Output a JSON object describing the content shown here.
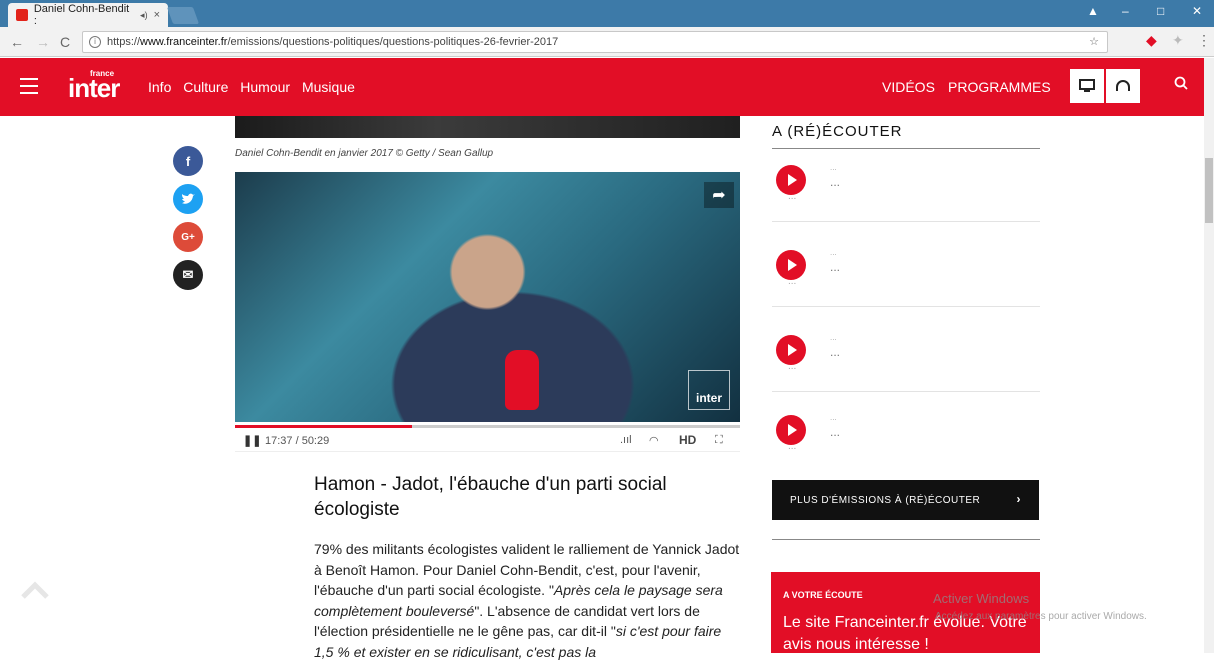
{
  "browser": {
    "tab_title": "Daniel Cohn-Bendit :",
    "tab_close": "×",
    "url_prefix": "https://",
    "url_host": "www.franceinter.fr",
    "url_path": "/emissions/questions-politiques/questions-politiques-26-fevrier-2017",
    "back": "←",
    "forward": "→",
    "reload": "C"
  },
  "header": {
    "logo_small": "france",
    "logo": "inter",
    "nav": [
      "Info",
      "Culture",
      "Humour",
      "Musique"
    ],
    "videos": "VIDÉOS",
    "programmes": "PROGRAMMES"
  },
  "social": {
    "facebook": "f",
    "twitter": "t",
    "google": "G+",
    "email": "✉"
  },
  "article": {
    "caption": "Daniel Cohn-Bendit en janvier 2017 © Getty / Sean Gallup",
    "video_watermark": "inter",
    "player_time": "17:37 / 50:29",
    "player_progress": 0.35,
    "player_hd": "HD",
    "headline": "Hamon - Jadot, l'ébauche d'un parti social écologiste",
    "body_1": "79% des militants écologistes valident le ralliement de Yannick Jadot à Benoît Hamon. Pour Daniel Cohn-Bendit, c'est, pour l'avenir, l'ébauche d'un parti social écologiste. \"",
    "body_em_1": "Après cela le paysage sera complètement bouleversé",
    "body_2": "\". L'absence de candidat vert lors de l'élection présidentielle ne le gêne pas, car dit-il \"",
    "body_em_2": "si c'est pour faire 1,5 % et exister en se ridiculisant, c'est pas la"
  },
  "sidebar": {
    "title": "A (RÉ)ÉCOUTER",
    "podcasts": [
      {
        "small": "...",
        "title": "...",
        "meta": "..."
      },
      {
        "small": "...",
        "title": "...",
        "meta": "..."
      },
      {
        "small": "...",
        "title": "...",
        "meta": "..."
      },
      {
        "small": "...",
        "title": "...",
        "meta": "..."
      }
    ],
    "more_button": "PLUS D'ÉMISSIONS À (RÉ)ÉCOUTER",
    "more_chevron": "›",
    "promo_kicker": "A VOTRE ÉCOUTE",
    "promo_text": "Le site Franceinter.fr évolue. Votre avis nous intéresse !"
  },
  "overlay": {
    "activate_title": "Activer Windows",
    "activate_sub": "Accédez aux paramètres pour activer Windows."
  },
  "colors": {
    "brand_red": "#e20e26",
    "tab_bar": "#3d7aa8",
    "facebook": "#3b5998",
    "twitter": "#1da1f2",
    "google": "#dd4b39",
    "email": "#222222"
  }
}
